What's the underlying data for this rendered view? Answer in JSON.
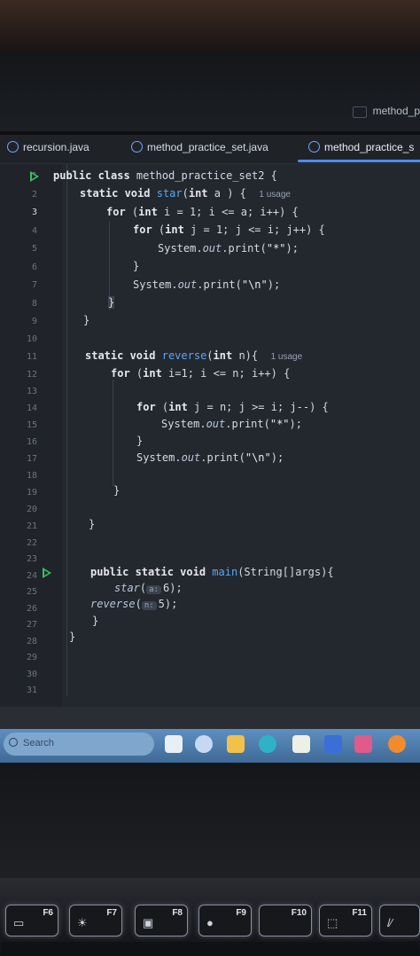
{
  "window": {
    "title_partial": "method_p"
  },
  "tabs": [
    {
      "label": "recursion.java",
      "active": false
    },
    {
      "label": "method_practice_set.java",
      "active": false
    },
    {
      "label": "method_practice_s",
      "active": true
    }
  ],
  "editor": {
    "line_numbers": [
      "1",
      "2",
      "3",
      "4",
      "5",
      "6",
      "7",
      "8",
      "9",
      "10",
      "11",
      "12",
      "13",
      "14",
      "15",
      "16",
      "17",
      "18",
      "19",
      "20",
      "21",
      "22",
      "23",
      "24",
      "25",
      "26",
      "27",
      "28",
      "29",
      "30",
      "31"
    ],
    "current_line": "3",
    "lines": {
      "l1": {
        "kw": "public class",
        "rest": " method_practice_set2 {"
      },
      "l2": {
        "kw1": "static void",
        "fn": "star",
        "p1": "(",
        "kw2": "int",
        "p2": " a ) {",
        "hint": "1 usage"
      },
      "l3": {
        "kw": "for",
        "rest": " (",
        "kw2": "int",
        "rest2": " i = 1; i <= a; i++) {"
      },
      "l4": {
        "kw": "for",
        "rest": " (",
        "kw2": "int",
        "rest2": " j = 1; j <= i; j++) {"
      },
      "l5": {
        "pre": "System.",
        "it": "out",
        "post": ".print(",
        "str": "\"*\"",
        "end": ");"
      },
      "l6": {
        "text": "}"
      },
      "l7": {
        "pre": "System.",
        "it": "out",
        "post": ".print(",
        "str": "\"\\n\"",
        "end": ");"
      },
      "l8": {
        "text": "}"
      },
      "l9": {
        "text": "}"
      },
      "l11": {
        "kw1": "static void",
        "fn": "reverse",
        "p1": "(",
        "kw2": "int",
        "p2": " n){",
        "hint": "1 usage"
      },
      "l12": {
        "kw": "for",
        "rest": " (",
        "kw2": "int",
        "rest2": " i=1; i <= n; i++) {"
      },
      "l14": {
        "kw": "for",
        "rest": " (",
        "kw2": "int",
        "rest2": " j = n; j >= i; j--) {"
      },
      "l15": {
        "pre": "System.",
        "it": "out",
        "post": ".print(",
        "str": "\"*\"",
        "end": ");"
      },
      "l16": {
        "text": "}"
      },
      "l17": {
        "pre": "System.",
        "it": "out",
        "post": ".print(",
        "str": "\"\\n\"",
        "end": ");"
      },
      "l19": {
        "text": "}"
      },
      "l21": {
        "text": "}"
      },
      "l24": {
        "kw": "public static void",
        "fn": "main",
        "rest": "(String[]args){"
      },
      "l25": {
        "it": "star",
        "open": "(",
        "chip": "a:",
        "val": "6",
        "close": ");"
      },
      "l26": {
        "it": "reverse",
        "open": "(",
        "chip": "n:",
        "val": "5",
        "close": ");"
      },
      "l27": {
        "text": "}"
      },
      "l28": {
        "text": "}"
      }
    }
  },
  "taskbar": {
    "search_placeholder": "Search"
  },
  "keyboard": {
    "keys": [
      "F6",
      "F7",
      "F8",
      "F9",
      "F10",
      "F11"
    ]
  },
  "colors": {
    "accent": "#4a8df7",
    "run": "#38c25f",
    "function": "#57a8f5"
  }
}
